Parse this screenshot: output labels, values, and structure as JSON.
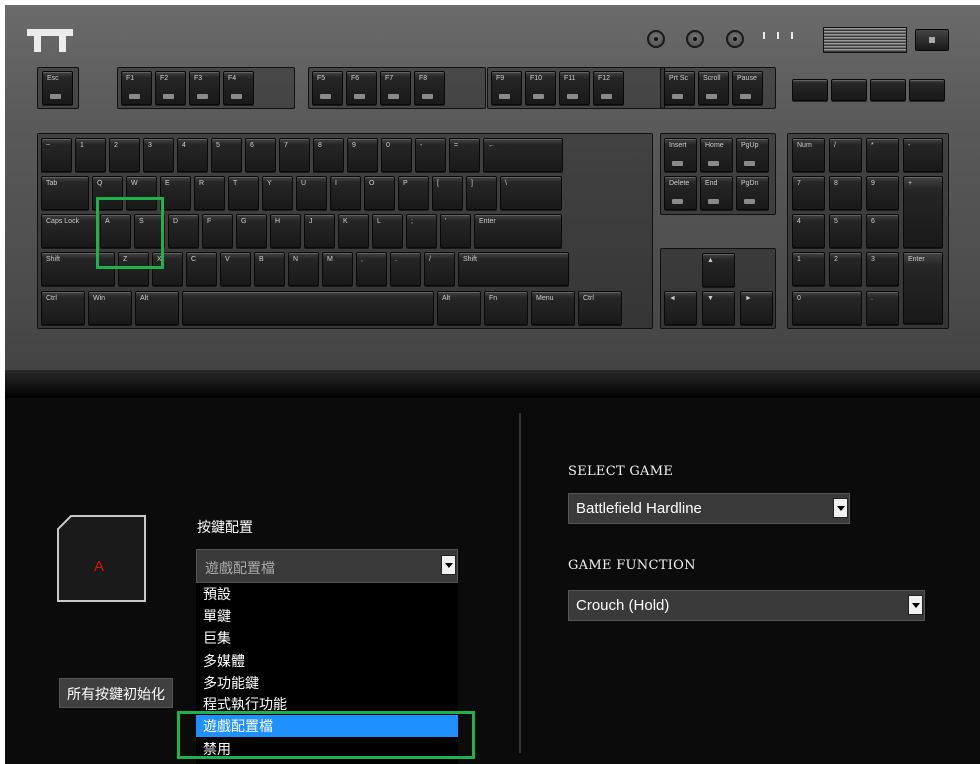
{
  "colors": {
    "accent_highlight": "#1fb24a",
    "selected_option": "#1e90ff",
    "key_letter": "#e01010"
  },
  "keyboard": {
    "brand_logo": "tt-logo",
    "rows": {
      "fkeys": [
        {
          "main": "Esc",
          "sub": ""
        },
        {
          "main": "F1",
          "sub": ""
        },
        {
          "main": "F2",
          "sub": ""
        },
        {
          "main": "F3",
          "sub": ""
        },
        {
          "main": "F4",
          "sub": ""
        },
        {
          "main": "F5",
          "sub": ""
        },
        {
          "main": "F6",
          "sub": ""
        },
        {
          "main": "F7",
          "sub": ""
        },
        {
          "main": "F8",
          "sub": ""
        },
        {
          "main": "F9",
          "sub": ""
        },
        {
          "main": "F10",
          "sub": ""
        },
        {
          "main": "F11",
          "sub": ""
        },
        {
          "main": "F12",
          "sub": ""
        },
        {
          "main": "Prt Sc",
          "sub": ""
        },
        {
          "main": "Scroll",
          "sub": ""
        },
        {
          "main": "Pause",
          "sub": ""
        }
      ],
      "number": [
        "~",
        "1",
        "2",
        "3",
        "4",
        "5",
        "6",
        "7",
        "8",
        "9",
        "0",
        "-",
        "=",
        "←"
      ],
      "qwerty": [
        "Tab",
        "Q",
        "W",
        "E",
        "R",
        "T",
        "Y",
        "U",
        "I",
        "O",
        "P",
        "[",
        "]",
        "\\"
      ],
      "home": [
        "Caps Lock",
        "A",
        "S",
        "D",
        "F",
        "G",
        "H",
        "J",
        "K",
        "L",
        ";",
        "'",
        "Enter"
      ],
      "shift": [
        "Shift",
        "Z",
        "X",
        "C",
        "V",
        "B",
        "N",
        "M",
        ",",
        ".",
        "/",
        "Shift"
      ],
      "bottom": [
        "Ctrl",
        "Win",
        "Alt",
        "",
        "Alt",
        "Fn",
        "Menu",
        "Ctrl"
      ]
    },
    "media_icons": [
      "stop-icon",
      "prev-icon",
      "play-pause-icon",
      "next-icon"
    ],
    "nav_keys": [
      "Insert",
      "Home",
      "PgUp",
      "Delete",
      "End",
      "PgDn"
    ],
    "arrow_keys": [
      "▲",
      "◄",
      "▼",
      "►"
    ],
    "numpad": [
      "Num",
      "/",
      "*",
      "-",
      "7",
      "8",
      "9",
      "+",
      "4",
      "5",
      "6",
      "1",
      "2",
      "3",
      "Enter",
      "0",
      "."
    ]
  },
  "key_config": {
    "selected_key_letter": "A",
    "title": "按鍵配置",
    "current_value": "遊戲配置檔",
    "options": [
      "預設",
      "單鍵",
      "巨集",
      "多媒體",
      "多功能鍵",
      "程式執行功能",
      "遊戲配置檔",
      "禁用"
    ],
    "selected_index": 6,
    "reset_all_label": "所有按鍵初始化"
  },
  "game": {
    "select_label": "SELECT GAME",
    "selected_game": "Battlefield Hardline",
    "function_label": "GAME FUNCTION",
    "selected_function": "Crouch (Hold)"
  }
}
